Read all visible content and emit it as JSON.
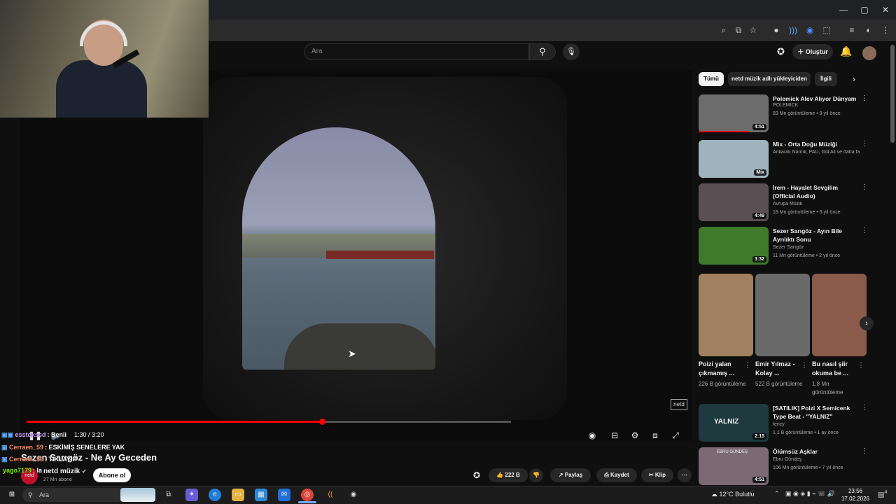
{
  "browser": {
    "window_controls": [
      "—",
      "▢",
      "✕"
    ]
  },
  "youtube_header": {
    "search_placeholder": "Ara",
    "create_label": "Oluştur"
  },
  "player": {
    "time_display": "1:30 / 3:20",
    "progress_fraction": 0.61,
    "buffered_fraction": 1.0,
    "watermark": "netd"
  },
  "video_info": {
    "title": "Sezen Sarıgöz - Ne Ay Geceden",
    "channel_name": "netd müzik",
    "channel_avatar_text": "netd",
    "subscribers": "27 Mn abone",
    "subscribe_label": "Abone ol",
    "like_count": "222 B",
    "share_label": "Paylaş",
    "save_label": "Kaydet",
    "clip_label": "Klip"
  },
  "chat": [
    {
      "user": "esstokssd",
      "message": ": Benli",
      "user_color": "#d7a8ff"
    },
    {
      "user": "Cerraen_59",
      "message": ": ESKİMİŞ SENELERE YAK",
      "user_color": "#ff8a65"
    },
    {
      "user": "Cerraen_59",
      "message": ": TIKLAYIP",
      "user_color": "#ff8a65"
    },
    {
      "user": "yago7179",
      "message": ": la",
      "user_color": "#7cfc00"
    }
  ],
  "sidebar": {
    "chips": [
      "Tümü",
      "netd müzik adlı yükleyiciden",
      "İlgili"
    ],
    "recommendations": [
      {
        "title": "Polemick  Alev Alıyor Dünyam",
        "channel": "POLEMICK",
        "meta": "83 Mn görüntüleme • 9 yıl önce",
        "duration": "4:51",
        "thumb_color": "#6c6c6c"
      },
      {
        "title": "Mix - Orta Doğu Müziği",
        "channel": "Ankaralı Namık, PAU, Gül Ali ve daha fazla",
        "meta": "",
        "duration": "Mix",
        "thumb_color": "#9fb3bd"
      },
      {
        "title": "İrem - Hayalet Sevgilim (Official Audio)",
        "channel": "Avrupa Müzik",
        "meta": "18 Mn görüntüleme • 6 yıl önce",
        "duration": "4:49",
        "thumb_color": "#5a4f53"
      },
      {
        "title": "Sezer Sarıgöz  - Ayın Bile Ayrılıktı Sonu",
        "channel": "Sezer Sarıgöz",
        "meta": "11 Mn görüntüleme • 2 yıl önce",
        "duration": "3:32",
        "thumb_color": "#3f7a2c"
      }
    ],
    "shorts": [
      {
        "title": "Poizi yalan çıkmamış ...",
        "views": "226 B görüntüleme",
        "color": "#a08060"
      },
      {
        "title": "Emir Yılmaz - Kolay ...",
        "views": "522 B görüntüleme",
        "color": "#6a6a6a"
      },
      {
        "title": "Bu nasıl şiir okuma be ...",
        "views": "1,8 Mn görüntüleme",
        "color": "#8a5a4a"
      }
    ],
    "recommendations2": [
      {
        "title": "[SATILIK] Poizi X Semicenk Type Beat - \"YALNIZ\"",
        "channel": "fenzy",
        "meta": "1,1 B görüntüleme • 1 ay önce",
        "duration": "2:15",
        "thumb_color": "#1f3a3e",
        "thumb_text": "YALNIZ"
      },
      {
        "title": "Ölümsüz Aşklar",
        "channel": "Ebru Gündeş",
        "meta": "106 Mn görüntüleme • 7 yıl önce",
        "duration": "4:51",
        "thumb_color": "#7b6a73",
        "thumb_text": "EBRU GÜNDEŞ"
      }
    ]
  },
  "taskbar": {
    "search_placeholder": "Ara",
    "weather": "12°C  Bulutlu",
    "time": "23:56",
    "date": "17.02.2026",
    "notification_count": "4"
  }
}
